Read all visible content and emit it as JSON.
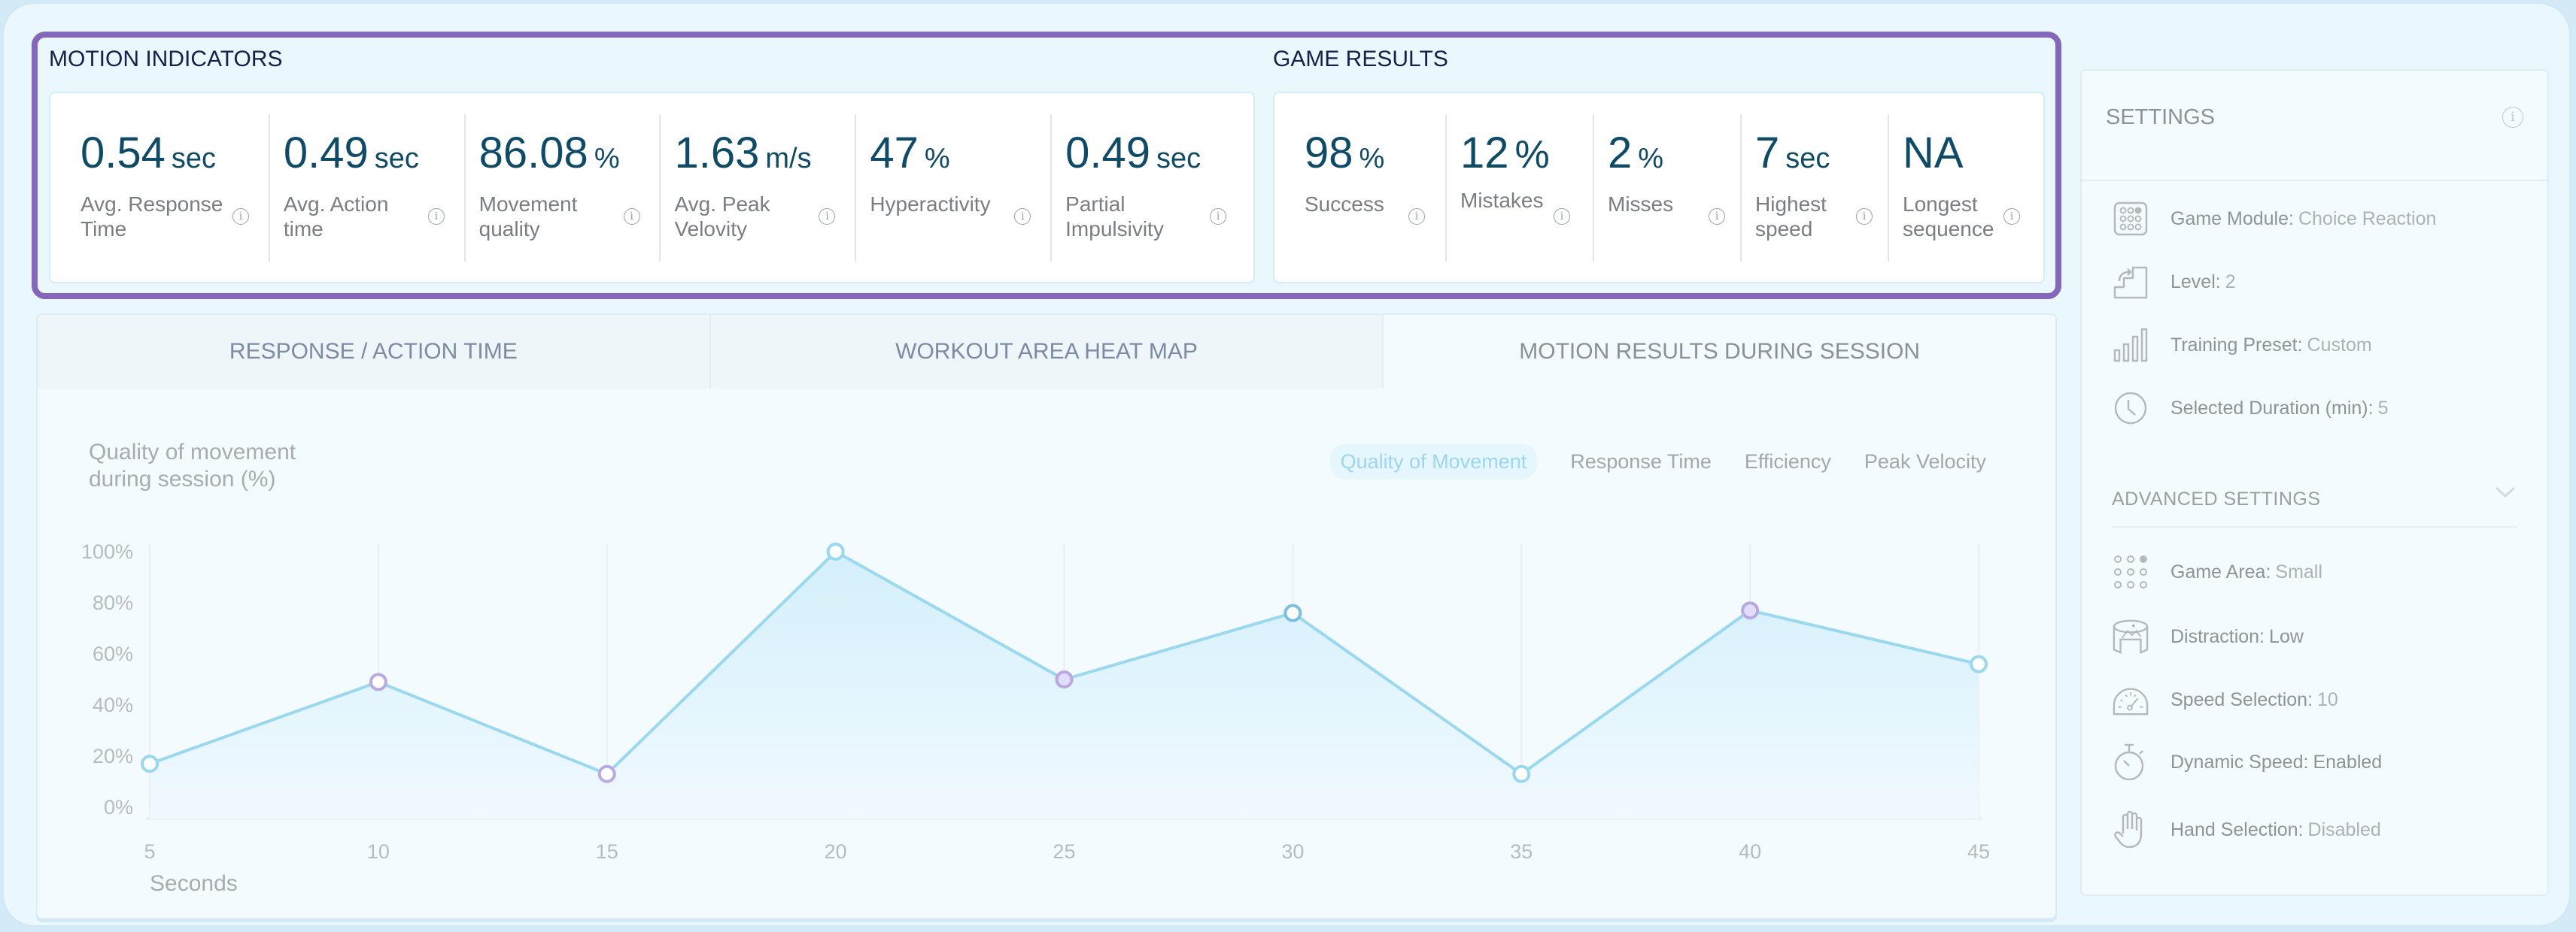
{
  "motion_indicators": {
    "title": "MOTION INDICATORS",
    "metrics": [
      {
        "value": "0.54",
        "unit": "sec",
        "label": "Avg. Response Time"
      },
      {
        "value": "0.49",
        "unit": "sec",
        "label": "Avg. Action time"
      },
      {
        "value": "86.08",
        "unit": "%",
        "label": "Movement quality"
      },
      {
        "value": "1.63",
        "unit": "m/s",
        "label": "Avg. Peak Velovity"
      },
      {
        "value": "47",
        "unit": "%",
        "label": "Hyperactivity"
      },
      {
        "value": "0.49",
        "unit": "sec",
        "label": "Partial Impulsivity"
      }
    ]
  },
  "game_results": {
    "title": "GAME RESULTS",
    "metrics": [
      {
        "value": "98",
        "unit": "%",
        "label": "Success"
      },
      {
        "value": "12",
        "unit": "%",
        "label": "Mistakes"
      },
      {
        "value": "2",
        "unit": "%",
        "label": "Misses"
      },
      {
        "value": "7",
        "unit": "sec",
        "label": "Highest speed"
      },
      {
        "value": "NA",
        "unit": "",
        "label": "Longest sequence"
      }
    ]
  },
  "info_glyph": "i",
  "tabs": [
    {
      "label": "RESPONSE / ACTION TIME",
      "active": false
    },
    {
      "label": "WORKOUT AREA HEAT MAP",
      "active": false
    },
    {
      "label": "MOTION RESULTS DURING SESSION",
      "active": true
    }
  ],
  "chart_panel": {
    "title_line1": "Quality of movement",
    "title_line2": "during session (%)",
    "chips": [
      {
        "label": "Quality of Movement",
        "active": true
      },
      {
        "label": "Response Time",
        "active": false
      },
      {
        "label": "Efficiency",
        "active": false
      },
      {
        "label": "Peak Velocity",
        "active": false
      }
    ]
  },
  "chart_data": {
    "type": "area",
    "title": "Quality of movement during session (%)",
    "xlabel": "Seconds",
    "ylabel": "",
    "x": [
      5,
      10,
      15,
      20,
      25,
      30,
      35,
      40,
      45
    ],
    "series": [
      {
        "name": "Quality of Movement",
        "values": [
          17,
          49,
          13,
          100,
          50,
          76,
          13,
          77,
          56
        ]
      }
    ],
    "point_styles": [
      "blue",
      "purple",
      "purple",
      "blue",
      "purple-filled",
      "dark-blue",
      "blue",
      "purple-filled",
      "blue"
    ],
    "ylim": [
      0,
      100
    ],
    "yticks": [
      0,
      20,
      40,
      60,
      80,
      100
    ],
    "ytick_labels": [
      "0%",
      "20%",
      "40%",
      "60%",
      "80%",
      "100%"
    ],
    "xticks": [
      5,
      10,
      15,
      20,
      25,
      30,
      35,
      40,
      45
    ],
    "xtick_labels": [
      "5",
      "10",
      "15",
      "20",
      "25",
      "30",
      "35",
      "40",
      "45"
    ],
    "grid": "vertical",
    "colors": {
      "line": "#9ad8f0",
      "fill_top": "#d3f0fc",
      "fill_bottom": "#f1f9fe",
      "purple": "#b9a9e0",
      "purple_fill": "#e1ddfa",
      "dark_blue": "#7cbfdc",
      "grid": "#e9eef2",
      "tick": "#b8bbbe"
    }
  },
  "settings": {
    "title": "SETTINGS",
    "items": [
      {
        "icon": "game-module-icon",
        "key": "Game Module:",
        "value": "Choice Reaction"
      },
      {
        "icon": "level-stairs-icon",
        "key": "Level:",
        "value": "2"
      },
      {
        "icon": "training-preset-bars-icon",
        "key": "Training Preset:",
        "value": "Custom"
      },
      {
        "icon": "clock-icon",
        "key": "Selected Duration (min):",
        "value": "5"
      }
    ],
    "advanced_title": "ADVANCED SETTINGS",
    "advanced_items": [
      {
        "icon": "game-area-dots-icon",
        "key": "Game Area:",
        "value": "Small"
      },
      {
        "icon": "distraction-panorama-icon",
        "key": "Distraction:",
        "value": "Low"
      },
      {
        "icon": "speedometer-icon",
        "key": "Speed Selection:",
        "value": "10"
      },
      {
        "icon": "stopwatch-icon",
        "key": "Dynamic Speed:",
        "value": "Enabled"
      },
      {
        "icon": "hand-icon",
        "key": "Hand Selection:",
        "value": "Disabled"
      }
    ]
  },
  "colors": {
    "accent_purple": "#8466bb",
    "value_text": "#0f4a66",
    "title_text": "#1a1f4a"
  }
}
